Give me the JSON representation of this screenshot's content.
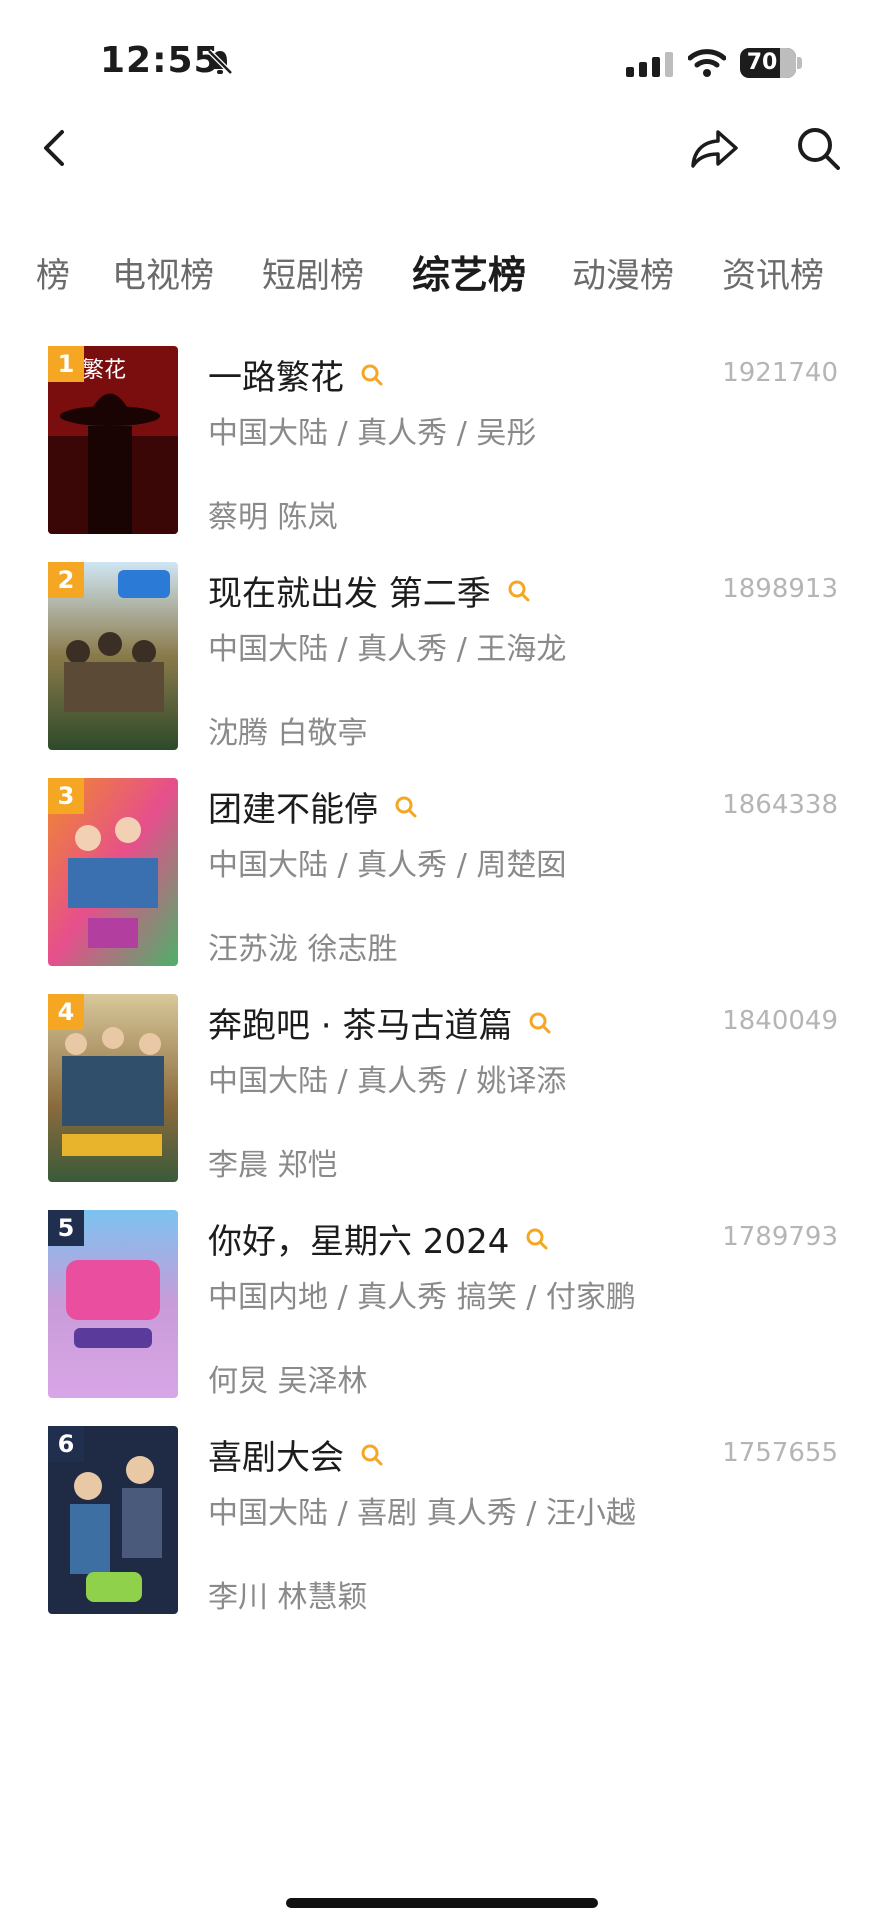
{
  "status": {
    "time": "12:55",
    "battery": "70"
  },
  "nav": {
    "back_icon": "chevron-left-icon",
    "share_icon": "share-arrow-icon",
    "search_icon": "search-icon"
  },
  "tabs": [
    "榜",
    "电视榜",
    "短剧榜",
    "综艺榜",
    "动漫榜",
    "资讯榜"
  ],
  "active_tab": "综艺榜",
  "colors": {
    "rank_top": "#f5a623",
    "rank_other": "#1f2f4d",
    "search_accent": "#f5a623",
    "meta": "#8a8a8a",
    "score": "#b5b5b5"
  },
  "items": [
    {
      "rank": "1",
      "title": "一路繁花",
      "meta": "中国大陆 / 真人秀 / 吴彤",
      "cast": "蔡明 陈岚",
      "score": "1921740",
      "poster_text": "路繁花"
    },
    {
      "rank": "2",
      "title": "现在就出发 第二季",
      "meta": "中国大陆 / 真人秀 / 王海龙",
      "cast": "沈腾 白敬亭",
      "score": "1898913",
      "poster_text": ""
    },
    {
      "rank": "3",
      "title": "团建不能停",
      "meta": "中国大陆 / 真人秀 / 周楚囡",
      "cast": "汪苏泷 徐志胜",
      "score": "1864338",
      "poster_text": ""
    },
    {
      "rank": "4",
      "title": "奔跑吧 · 茶马古道篇",
      "meta": "中国大陆 / 真人秀 / 姚译添",
      "cast": "李晨 郑恺",
      "score": "1840049",
      "poster_text": ""
    },
    {
      "rank": "5",
      "title": "你好，星期六 2024",
      "meta": "中国内地 / 真人秀 搞笑 / 付家鹏",
      "cast": "何炅 吴泽林",
      "score": "1789793",
      "poster_text": ""
    },
    {
      "rank": "6",
      "title": "喜剧大会",
      "meta": "中国大陆 / 喜剧 真人秀 / 汪小越",
      "cast": "李川 林慧颖",
      "score": "1757655",
      "poster_text": ""
    }
  ]
}
